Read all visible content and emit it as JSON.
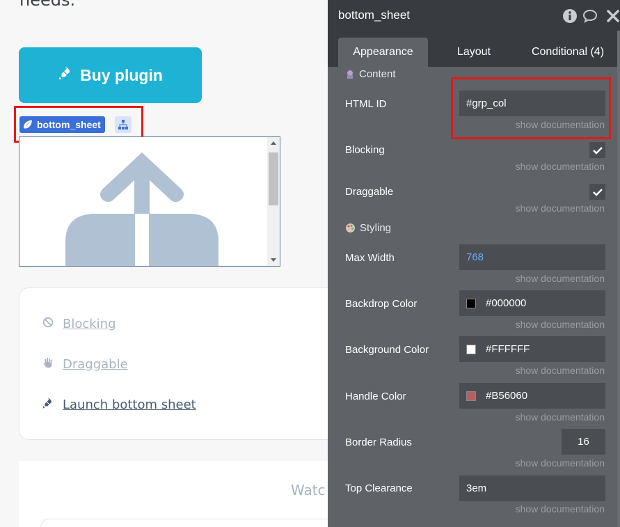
{
  "canvas": {
    "top_text": "needs.",
    "buy_button": "Buy plugin",
    "element_tag": "bottom_sheet",
    "options": [
      {
        "label": "Blocking",
        "icon": "ban-icon"
      },
      {
        "label": "Draggable",
        "icon": "hand-icon"
      },
      {
        "label": "Launch bottom sheet",
        "icon": "rocket-icon"
      }
    ],
    "watch_text": "Watc"
  },
  "panel": {
    "title": "bottom_sheet",
    "tabs": [
      "Appearance",
      "Layout",
      "Conditional (4)"
    ],
    "active_tab": "Appearance",
    "section_content": "Content",
    "section_styling": "Styling",
    "doc_link": "show documentation",
    "fields": {
      "html_id": {
        "label": "HTML ID",
        "value": "#grp_col"
      },
      "blocking": {
        "label": "Blocking",
        "checked": true
      },
      "draggable": {
        "label": "Draggable",
        "checked": true
      },
      "max_width": {
        "label": "Max Width",
        "value": "768"
      },
      "backdrop_color": {
        "label": "Backdrop Color",
        "value": "#000000"
      },
      "background_color": {
        "label": "Background Color",
        "value": "#FFFFFF"
      },
      "handle_color": {
        "label": "Handle Color",
        "value": "#B56060"
      },
      "border_radius": {
        "label": "Border Radius",
        "value": "16"
      },
      "top_clearance": {
        "label": "Top Clearance",
        "value": "3em"
      }
    }
  },
  "colors": {
    "buy_button": "#1eb2d4",
    "panel_bg": "#5f6368",
    "panel_header": "#383c40",
    "highlight": "#e21a1a",
    "tag": "#3b6fd8"
  }
}
